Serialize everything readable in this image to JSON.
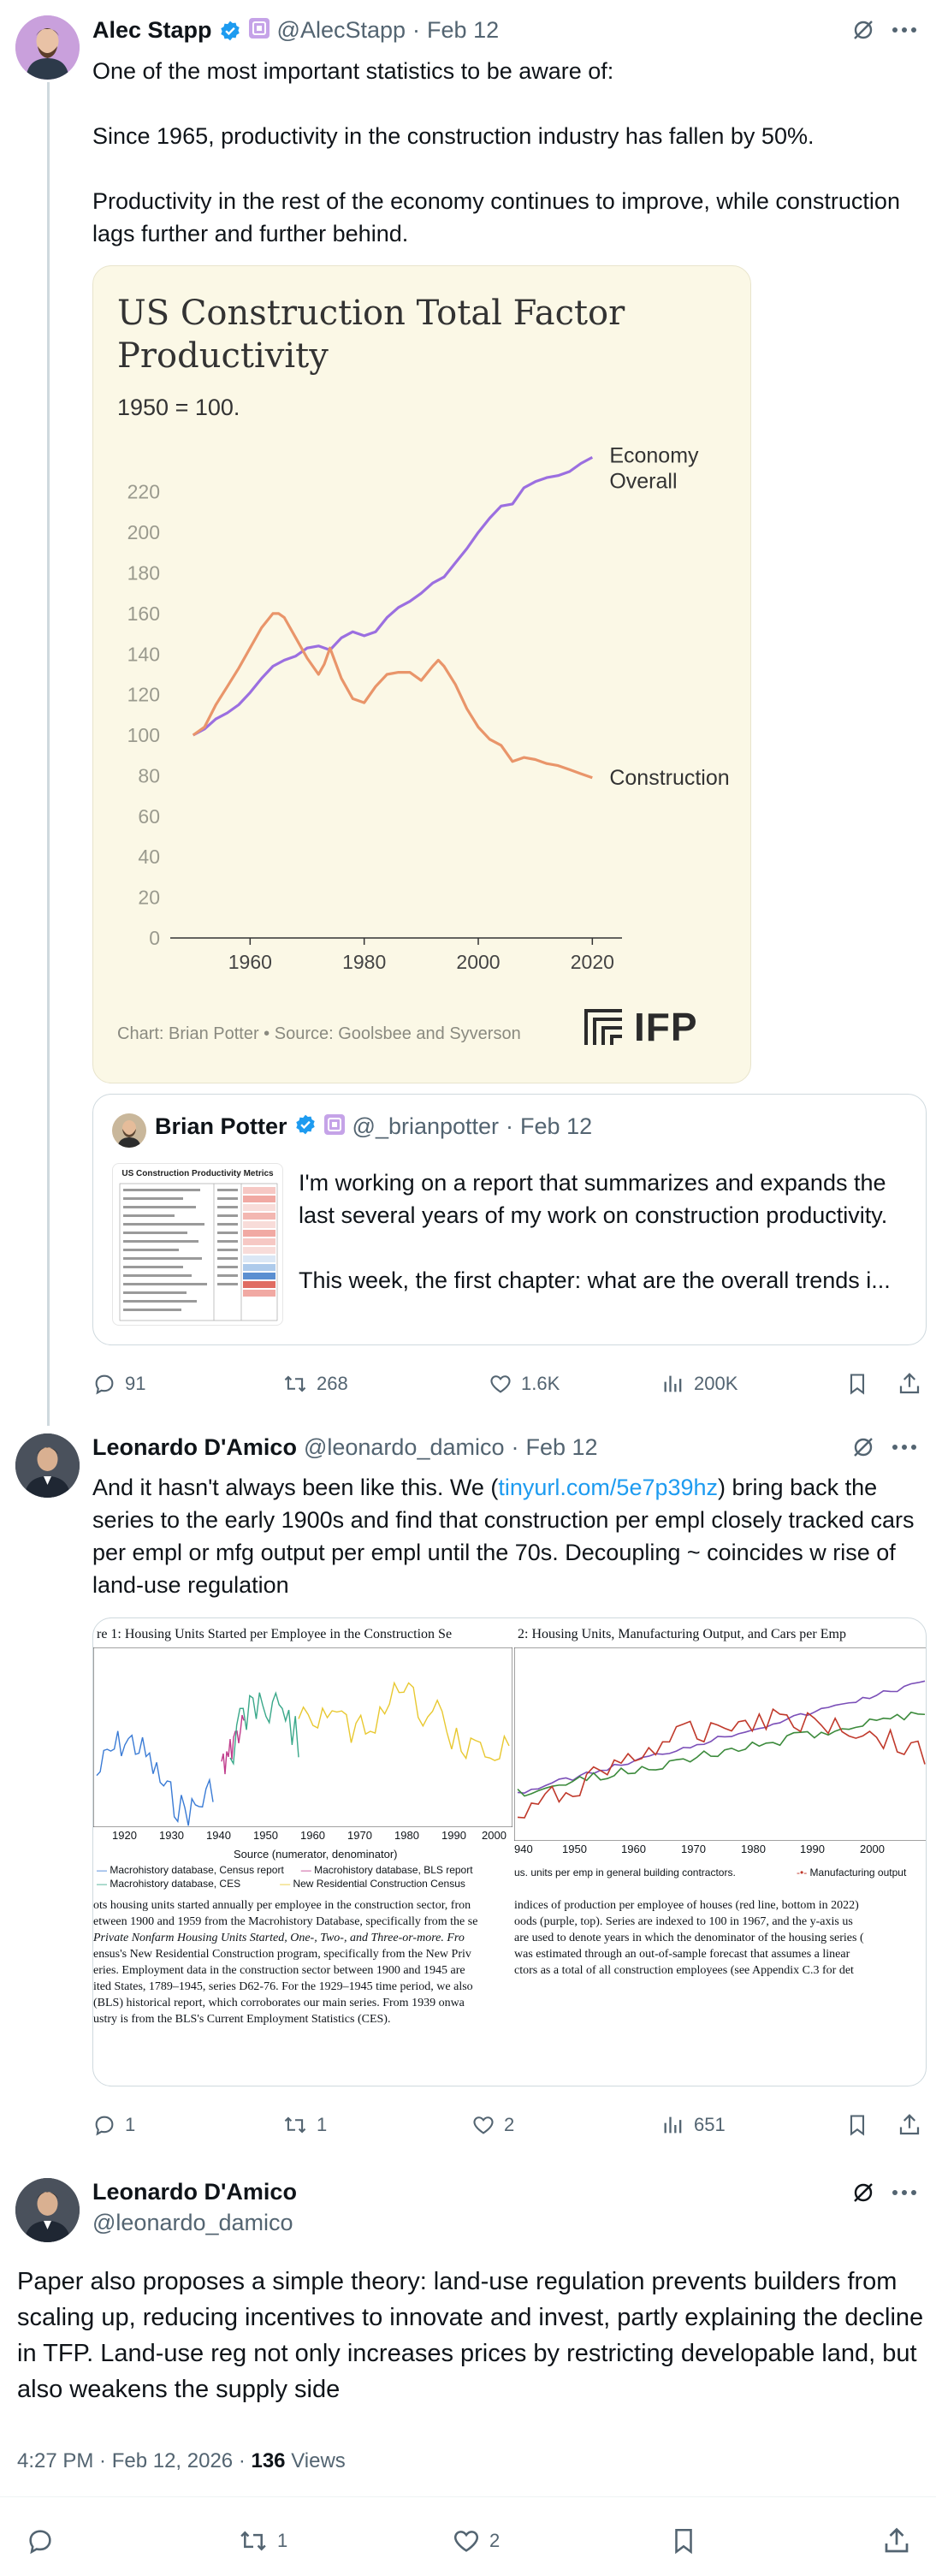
{
  "tweet1": {
    "name": "Alec Stapp",
    "handle": "@AlecStapp",
    "date": "Feb 12",
    "text": [
      "One of the most important statistics to be aware of:",
      "Since 1965, productivity in the construction industry has fallen by 50%.",
      "Productivity in the rest of the economy continues to improve, while construction lags further and further behind."
    ],
    "chart_card": {
      "footer": "Chart: Brian Potter • Source: Goolsbee and Syverson",
      "logo": "IFP"
    },
    "quote": {
      "name": "Brian Potter",
      "handle": "@_brianpotter",
      "date": "Feb 12",
      "thumb_title": "US Construction Productivity Metrics",
      "text1": "I'm working on a report that summarizes and expands the last several years of my work on construction productivity.",
      "text2": "This week, the first chapter: what are the overall trends i..."
    },
    "actions": {
      "replies": "91",
      "reposts": "268",
      "likes": "1.6K",
      "views": "200K"
    }
  },
  "chart_data": {
    "type": "line",
    "title": "US Construction Total Factor Productivity",
    "subtitle": "1950 = 100.",
    "xlabel": "",
    "ylabel": "",
    "xlim": [
      1946,
      2024
    ],
    "ylim": [
      0,
      230
    ],
    "x_ticks": [
      1960,
      1980,
      2000,
      2020
    ],
    "y_ticks": [
      0,
      20,
      40,
      60,
      80,
      100,
      120,
      140,
      160,
      180,
      200,
      220
    ],
    "grid": false,
    "series": [
      {
        "name": "Economy Overall",
        "color": "#9b6fe0",
        "x": [
          1950,
          1952,
          1954,
          1956,
          1958,
          1960,
          1962,
          1964,
          1966,
          1968,
          1970,
          1972,
          1974,
          1976,
          1978,
          1980,
          1982,
          1984,
          1986,
          1988,
          1990,
          1992,
          1994,
          1996,
          1998,
          2000,
          2002,
          2004,
          2006,
          2008,
          2010,
          2012,
          2014,
          2016,
          2018,
          2020
        ],
        "y": [
          100,
          103,
          108,
          111,
          115,
          121,
          128,
          134,
          137,
          139,
          143,
          144,
          142,
          148,
          151,
          149,
          151,
          158,
          163,
          166,
          170,
          175,
          178,
          185,
          192,
          200,
          207,
          213,
          214,
          222,
          225,
          227,
          228,
          230,
          234,
          237
        ]
      },
      {
        "name": "Construction",
        "color": "#e9956a",
        "x": [
          1950,
          1952,
          1954,
          1956,
          1958,
          1960,
          1962,
          1964,
          1965,
          1966,
          1968,
          1970,
          1972,
          1973,
          1974,
          1976,
          1978,
          1980,
          1982,
          1984,
          1986,
          1988,
          1990,
          1992,
          1993,
          1994,
          1996,
          1998,
          2000,
          2002,
          2004,
          2006,
          2008,
          2010,
          2012,
          2014,
          2016,
          2018,
          2020
        ],
        "y": [
          100,
          104,
          115,
          124,
          133,
          143,
          153,
          160,
          160,
          158,
          148,
          138,
          130,
          135,
          143,
          128,
          118,
          116,
          124,
          130,
          131,
          131,
          127,
          134,
          137,
          134,
          125,
          113,
          104,
          98,
          95,
          87,
          89,
          88,
          86,
          85,
          83,
          81,
          79
        ]
      }
    ],
    "series_label_economy_1": "Economy",
    "series_label_economy_2": "Overall",
    "series_label_construction": "Construction"
  },
  "tweet2": {
    "name": "Leonardo D'Amico",
    "handle": "@leonardo_damico",
    "date": "Feb 12",
    "text_before_link": "And it hasn't always been like this. We (",
    "link": "tinyurl.com/5e7p39hz",
    "text_after_link": ") bring back the series to the early 1900s and find that construction per empl closely tracked cars per empl or mfg output per empl until the 70s. Decoupling ~ coincides w rise of land-use regulation",
    "fig_left": {
      "title": "re 1: Housing Units Started per Employee in the Construction Se",
      "x_ticks": [
        "1920",
        "1930",
        "1940",
        "1950",
        "1960",
        "1970",
        "1980",
        "1990",
        "2000"
      ],
      "axis_title": "Source (numerator, denominator)",
      "legend": [
        "Macrohistory database, Census report",
        "Macrohistory database, BLS report",
        "Macrohistory database, CES",
        "New Residential Construction Census"
      ],
      "caption": [
        "ots housing units started annually per employee in the construction sector, fron",
        "etween 1900 and 1959 from the Macrohistory Database, specifically from the se",
        "Private Nonfarm Housing Units Started, One-, Two-, and Three-or-more. Fro",
        "ensus's New Residential Construction program, specifically from the New Priv",
        "eries. Employment data in the construction sector between 1900 and 1945 are",
        "ited States, 1789–1945, series D62-76. For the 1929–1945 time period, we also",
        "(BLS) historical report, which corroborates our main series. From 1939 onwa",
        "ustry is from the BLS's Current Employment Statistics (CES)."
      ]
    },
    "fig_right": {
      "title": "2: Housing Units, Manufacturing Output, and Cars per Emp",
      "x_ticks": [
        "940",
        "1950",
        "1960",
        "1970",
        "1980",
        "1990",
        "2000"
      ],
      "legend_line": "us. units per emp in general building contractors.",
      "legend_mfg": "Manufacturing output",
      "caption": [
        "indices of production per employee of houses (red line, bottom in 2022)",
        "oods (purple, top). Series are indexed to 100 in 1967, and the y-axis us",
        "are used to denote years in which the denominator of the housing series (",
        "was estimated through an out-of-sample forecast that assumes a linear",
        "ctors as a total of all construction employees (see Appendix C.3 for det"
      ]
    },
    "actions": {
      "replies": "1",
      "reposts": "1",
      "likes": "2",
      "views": "651"
    }
  },
  "tweet3": {
    "name": "Leonardo D'Amico",
    "handle": "@leonardo_damico",
    "text": "Paper also proposes a simple theory: land-use regulation prevents builders from scaling up, reducing incentives to innovate and invest, partly explaining the decline in TFP. Land-use reg not only increases prices by restricting developable land, but also weakens the supply side",
    "time": "4:27 PM · Feb 12, 2026 · ",
    "views_count": "136",
    "views_label": " Views",
    "actions": {
      "reposts": "1",
      "likes": "2"
    }
  },
  "colors": {
    "accent": "#1d9bf0",
    "chart_bg": "#fbf8e6",
    "economy": "#9b6fe0",
    "construction": "#e9956a",
    "muted": "#536471"
  }
}
